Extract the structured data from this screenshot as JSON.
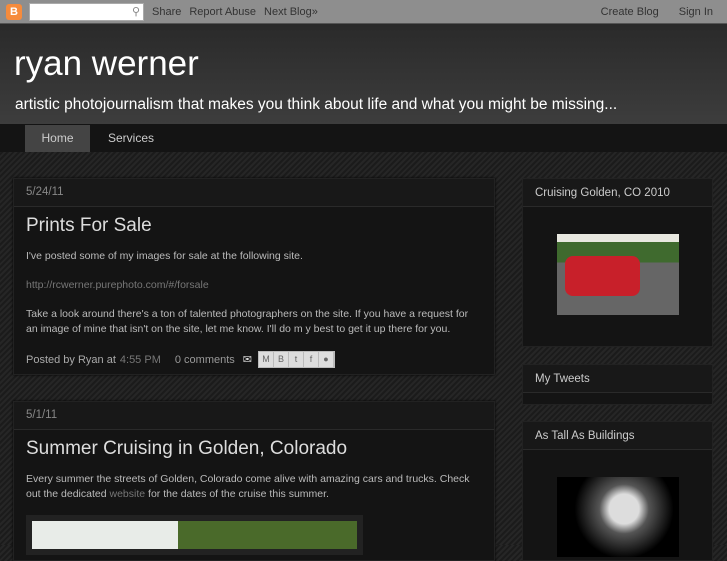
{
  "navbar": {
    "search_placeholder": "",
    "links": [
      "Share",
      "Report Abuse",
      "Next Blog»"
    ],
    "right": [
      "Create Blog",
      "Sign In"
    ]
  },
  "header": {
    "title": "ryan werner",
    "description": "artistic photojournalism that makes you think about life and what you might be missing..."
  },
  "tabs": [
    "Home",
    "Services"
  ],
  "posts": [
    {
      "date": "5/24/11",
      "title": "Prints For Sale",
      "p1": "I've posted some of my images for sale at the following site.",
      "link": "http://rcwerner.purephoto.com/#/forsale",
      "p2": "Take a look around there's a ton of talented photographers on the site. If you have a request for an image of mine that isn't on the site, let me know. I'll do m y best to get it up there for you.",
      "posted_by": "Posted by Ryan at",
      "time": "4:55 PM",
      "comments": "0 comments"
    },
    {
      "date": "5/1/11",
      "title": "Summer Cruising in Golden, Colorado",
      "p1_a": "Every summer the streets of Golden, Colorado come alive with amazing cars and trucks. Check out the dedicated",
      "p1_link": "website",
      "p1_b": "for the dates of the cruise this summer."
    }
  ],
  "sidebar": [
    "Cruising Golden, CO 2010",
    "My Tweets",
    "As Tall As Buildings"
  ]
}
